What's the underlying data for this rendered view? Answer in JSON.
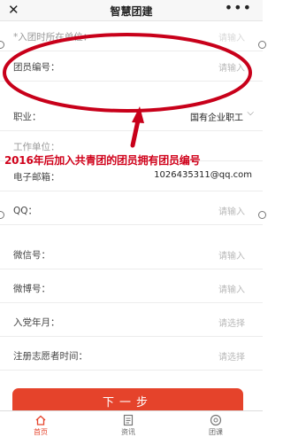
{
  "header": {
    "close_icon": "close-icon",
    "title": "智慧团建",
    "more_icon": "more-icon",
    "more_glyph": "•••"
  },
  "form": {
    "rows": [
      {
        "label": "*入团时所在单位：",
        "value": "请输入"
      },
      {
        "label": "团员编号：",
        "value": "请输入"
      },
      {
        "label": "职业：",
        "value": "国有企业职工"
      },
      {
        "label": "工作单位：",
        "value": ""
      },
      {
        "label": "电子邮箱：",
        "value": "1026435311@qq.com"
      },
      {
        "label": "QQ：",
        "value": "请输入"
      },
      {
        "label": "微信号：",
        "value": "请输入"
      },
      {
        "label": "微博号：",
        "value": "请输入"
      },
      {
        "label": "入党年月：",
        "value": "请选择"
      },
      {
        "label": "注册志愿者时间：",
        "value": "请选择"
      }
    ]
  },
  "annotation": {
    "text": "2016年后加入共青团的团员拥有团员编号",
    "color": "#d0021b"
  },
  "next_button": {
    "label": "下一步"
  },
  "tabbar": {
    "items": [
      {
        "label": "首页",
        "icon": "home-icon",
        "active": true
      },
      {
        "label": "资讯",
        "icon": "news-icon",
        "active": false
      },
      {
        "label": "团课",
        "icon": "course-icon",
        "active": false
      }
    ]
  },
  "colors": {
    "accent": "#e5432b",
    "annotation": "#d0021b"
  }
}
